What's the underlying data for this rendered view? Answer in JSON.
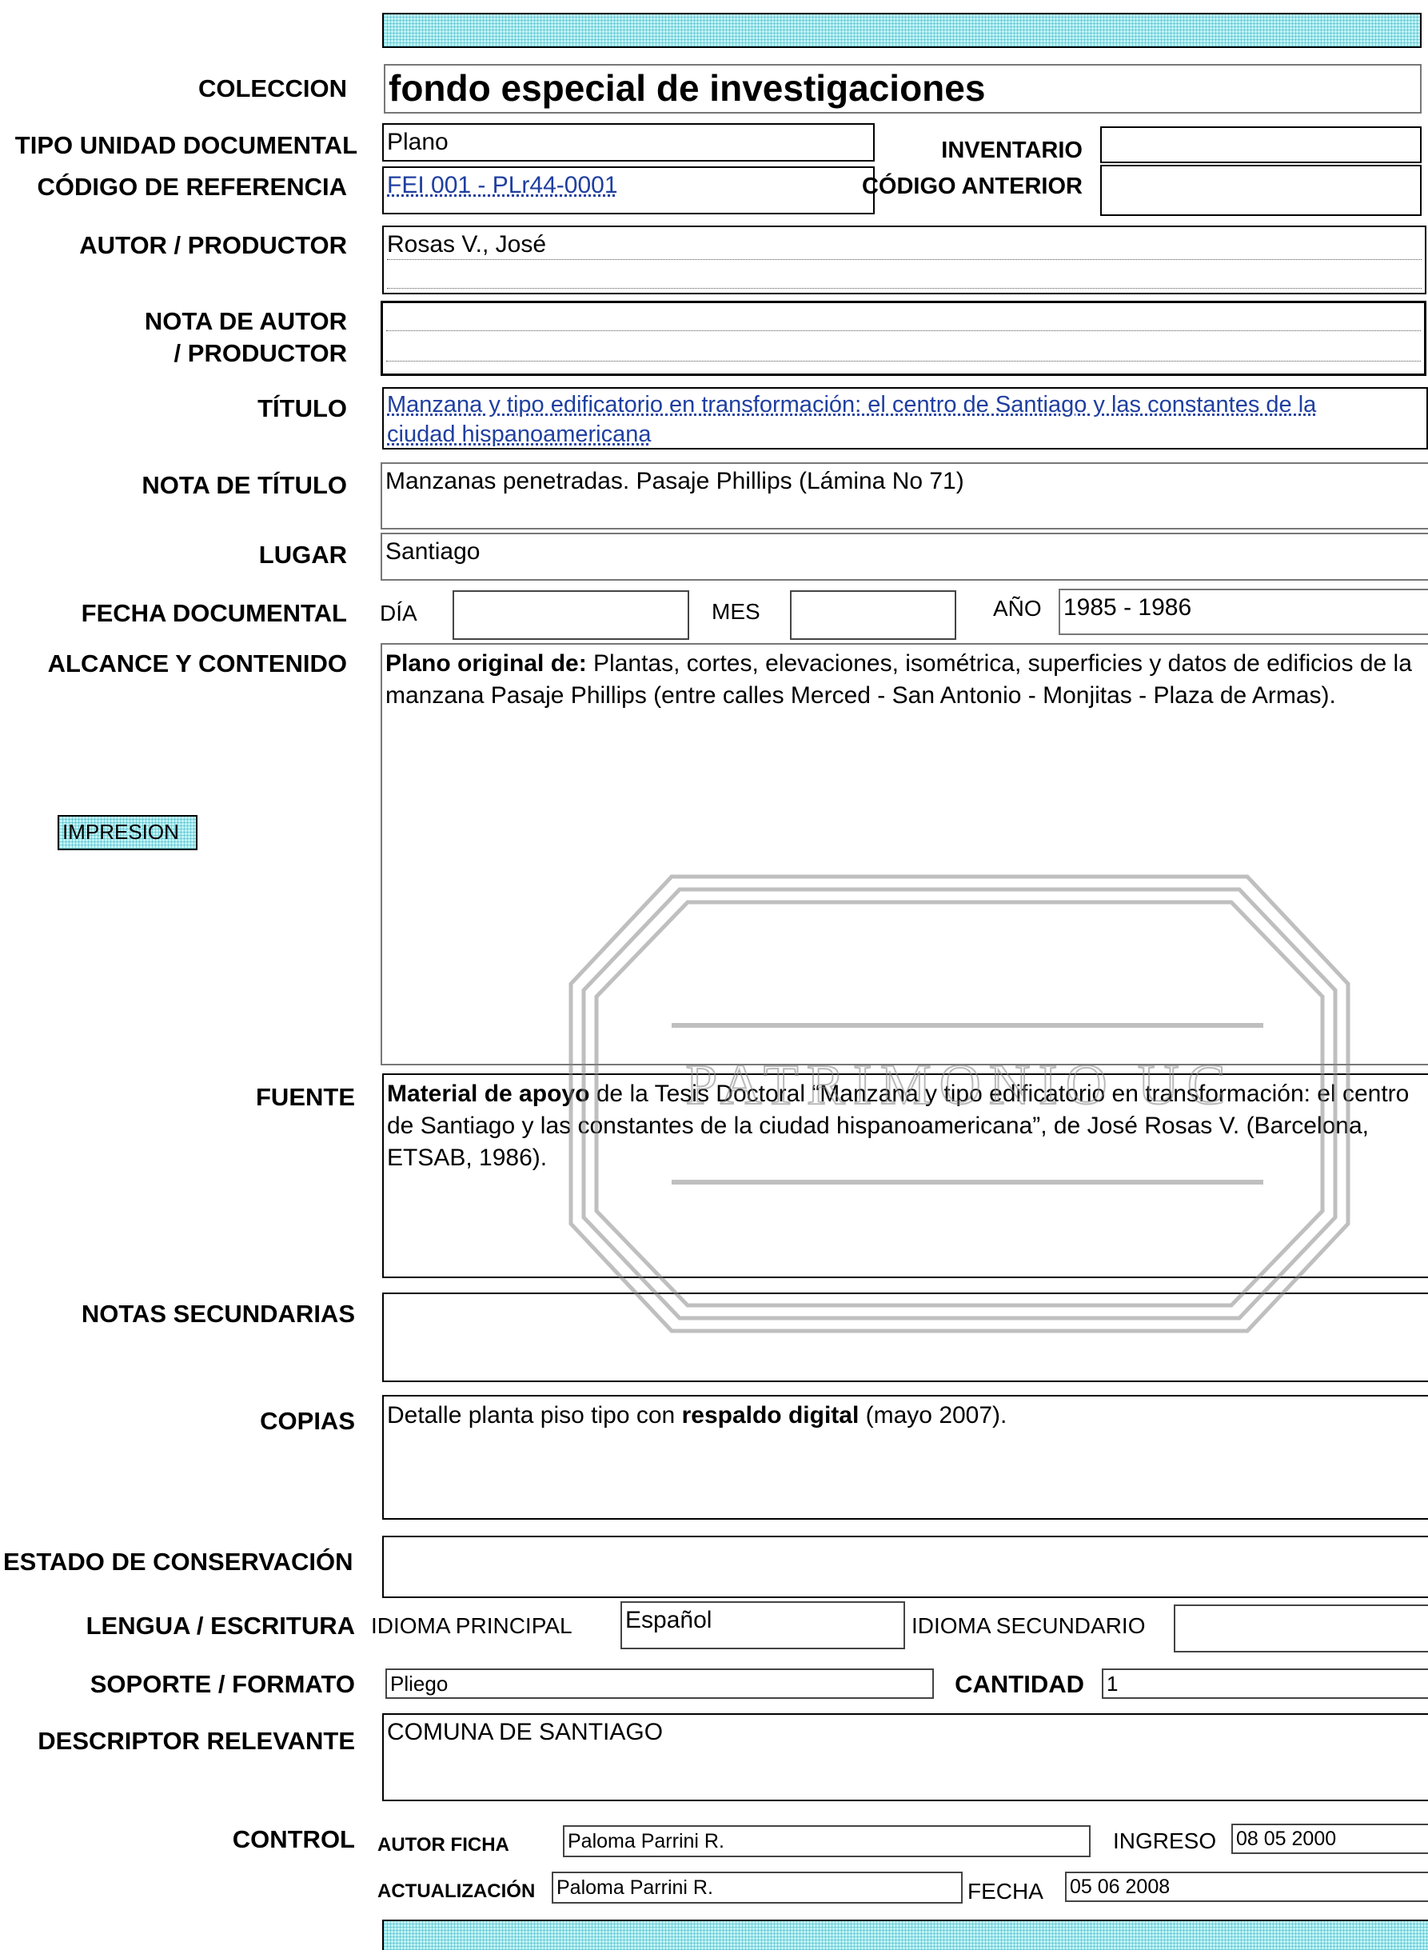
{
  "header": {
    "bar": ""
  },
  "labels": {
    "coleccion": "COLECCION",
    "tipo_unidad": "TIPO UNIDAD DOCUMENTAL",
    "inventario": "INVENTARIO",
    "codigo_referencia": "CÓDIGO DE REFERENCIA",
    "codigo_anterior": "CÓDIGO ANTERIOR",
    "autor": "AUTOR / PRODUCTOR",
    "nota_autor_1": "NOTA DE AUTOR",
    "nota_autor_2": "/ PRODUCTOR",
    "titulo": "TÍTULO",
    "nota_titulo": "NOTA DE TÍTULO",
    "lugar": "LUGAR",
    "fecha_documental": "FECHA DOCUMENTAL",
    "dia": "DÍA",
    "mes": "MES",
    "anio": "AÑO",
    "alcance": "ALCANCE Y CONTENIDO",
    "fuente": "FUENTE",
    "notas_secundarias": "NOTAS SECUNDARIAS",
    "copias": "COPIAS",
    "estado": "ESTADO DE CONSERVACIÓN",
    "lengua": "LENGUA / ESCRITURA",
    "idioma_principal": "IDIOMA PRINCIPAL",
    "idioma_secundario": "IDIOMA SECUNDARIO",
    "soporte": "SOPORTE / FORMATO",
    "cantidad": "CANTIDAD",
    "descriptor": "DESCRIPTOR RELEVANTE",
    "control": "CONTROL",
    "autor_ficha": "AUTOR FICHA",
    "ingreso": "INGRESO",
    "actualizacion": "ACTUALIZACIÓN",
    "fecha": "FECHA"
  },
  "values": {
    "coleccion": "fondo especial de investigaciones",
    "tipo_unidad": "Plano",
    "inventario": "",
    "codigo_referencia": "FEI 001 - PLr44-0001",
    "codigo_anterior": "",
    "autor": "Rosas V., José",
    "nota_autor": "",
    "titulo_line1": "Manzana y tipo edificatorio en transformación: el centro de Santiago y las constantes de la",
    "titulo_line2": "ciudad hispanoamericana",
    "nota_titulo": "Manzanas penetradas. Pasaje Phillips (Lámina No 71)",
    "lugar": "Santiago",
    "dia": "",
    "mes": "",
    "anio": "1985 - 1986",
    "alcance_bold": "Plano original de:",
    "alcance_text": " Plantas, cortes, elevaciones, isométrica, superficies y datos de edificios de la manzana Pasaje Phillips (entre calles Merced - San Antonio - Monjitas - Plaza de Armas).",
    "fuente_bold": "Material de apoyo",
    "fuente_text": " de la Tesis Doctoral “Manzana y tipo edificatorio en transformación: el centro de Santiago y las constantes de la ciudad hispanoamericana”, de José Rosas V. (Barcelona, ETSAB, 1986).",
    "notas_secundarias": "",
    "copias_pre": "Detalle planta piso tipo con ",
    "copias_bold": "respaldo digital",
    "copias_post": " (mayo 2007).",
    "estado": "",
    "idioma_principal": "Español",
    "idioma_secundario": "",
    "soporte": "Pliego",
    "cantidad": "1",
    "descriptor": "COMUNA DE SANTIAGO",
    "autor_ficha": "Paloma Parrini R.",
    "ingreso": "08 05 2000",
    "actualizacion": "Paloma Parrini R.",
    "fecha": "05 06 2008"
  },
  "buttons": {
    "impresion": "IMPRESION"
  },
  "watermark": {
    "text": "PATRIMONIO UC"
  },
  "colors": {
    "hatch": "#bff3f6",
    "link": "#1f3fa0"
  }
}
